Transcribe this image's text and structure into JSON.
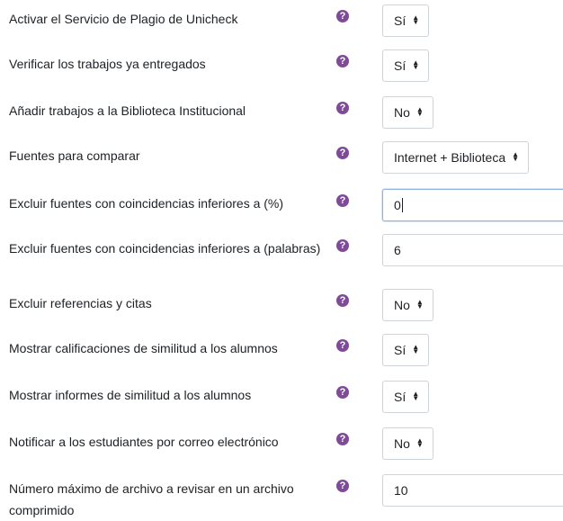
{
  "fields": [
    {
      "label": "Activar el Servicio de Plagio de Unicheck",
      "type": "select",
      "value": "Sí"
    },
    {
      "label": "Verificar los trabajos ya entregados",
      "type": "select",
      "value": "Sí"
    },
    {
      "label": "Añadir trabajos a la Biblioteca Institucional",
      "type": "select",
      "value": "No"
    },
    {
      "label": "Fuentes para comparar",
      "type": "select",
      "value": "Internet + Biblioteca"
    },
    {
      "label": "Excluir fuentes con coincidencias inferiores a (%)",
      "type": "input",
      "value": "0"
    },
    {
      "label": "Excluir fuentes con coincidencias inferiores a (palabras)",
      "type": "input",
      "value": "6"
    },
    {
      "label": "Excluir referencias y citas",
      "type": "select",
      "value": "No"
    },
    {
      "label": "Mostrar calificaciones de similitud a los alumnos",
      "type": "select",
      "value": "Sí"
    },
    {
      "label": "Mostrar informes de similitud a los alumnos",
      "type": "select",
      "value": "Sí"
    },
    {
      "label": "Notificar a los estudiantes por correo electrónico",
      "type": "select",
      "value": "No"
    },
    {
      "label": "Número máximo de archivo a revisar en un archivo comprimido",
      "type": "input",
      "value": "10"
    }
  ],
  "icons": {
    "help": "question-circle-icon",
    "caret": "sort-arrows-icon"
  },
  "colors": {
    "help_icon": "#7f4b98",
    "focus_border": "#8fb4e3",
    "border": "#ced4da",
    "text": "#1d2125"
  }
}
